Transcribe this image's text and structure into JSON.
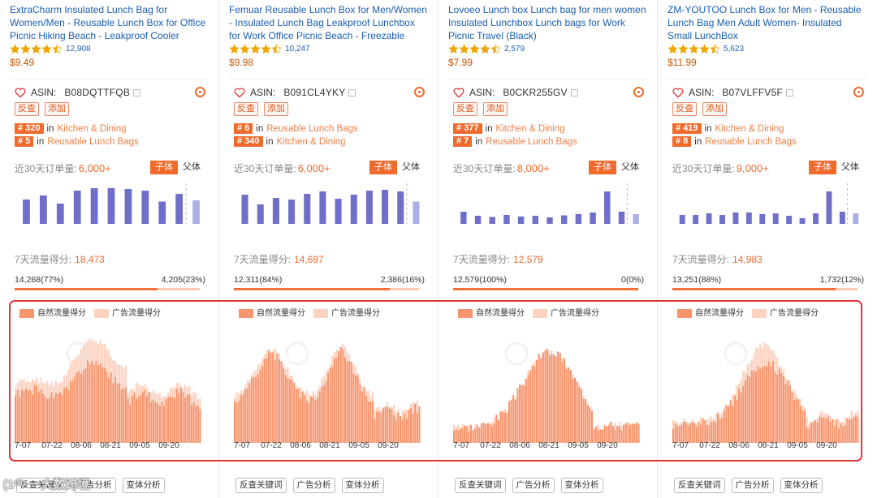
{
  "products": [
    {
      "title": "ExtraCharm Insulated Lunch Bag for Women/Men - Reusable Lunch Box for Office Picnic Hiking Beach - Leakproof Cooler Tote…",
      "rating_count": "12,908",
      "price": "$9.49",
      "asin_label": "ASIN:",
      "asin": "B08DQTTFQB",
      "tags": [
        "反查",
        "添加"
      ],
      "ranks": [
        {
          "num": "# 320",
          "in": "in",
          "cat": "Kitchen & Dining"
        },
        {
          "num": "# 5",
          "in": "in",
          "cat": "Reusable Lunch Bags"
        }
      ],
      "orders_label": "近30天订单量:",
      "orders_value": "6,000+",
      "toggle": [
        "子体",
        "父体"
      ],
      "bars": [
        0.6,
        0.7,
        0.5,
        0.82,
        0.88,
        0.88,
        0.86,
        0.82,
        0.55,
        0.74,
        0.58
      ],
      "traffic_label": "7天流量得分:",
      "traffic_value": "18,473",
      "natural": "14,268(77%)",
      "ads": "4,205(23%)",
      "natural_pct": 77,
      "legend": [
        "自然流量得分",
        "广告流量得分"
      ],
      "x_ticks": [
        "7-07",
        "07-22",
        "08-06",
        "08-21",
        "09-05",
        "09-20"
      ],
      "buttons": [
        "反查关键词",
        "广告分析",
        "变体分析"
      ],
      "seed": 1,
      "shape": "a"
    },
    {
      "title": "Femuar Reusable Lunch Box for Men/Women - Insulated Lunch Bag Leakproof Lunchbox for Work Office Picnic Beach - Freezable Lunch…",
      "rating_count": "10,247",
      "price": "$9.98",
      "asin_label": "ASIN:",
      "asin": "B091CL4YKY",
      "tags": [
        "反查",
        "添加"
      ],
      "ranks": [
        {
          "num": "# 6",
          "in": "in",
          "cat": "Reusable Lunch Bags"
        },
        {
          "num": "# 340",
          "in": "in",
          "cat": "Kitchen & Dining"
        }
      ],
      "orders_label": "近30天订单量:",
      "orders_value": "6,000+",
      "toggle": [
        "子体",
        "父体"
      ],
      "bars": [
        0.72,
        0.48,
        0.64,
        0.6,
        0.74,
        0.8,
        0.62,
        0.72,
        0.82,
        0.84,
        0.8,
        0.55
      ],
      "traffic_label": "7天流量得分:",
      "traffic_value": "14,697",
      "natural": "12,311(84%)",
      "ads": "2,386(16%)",
      "natural_pct": 84,
      "legend": [
        "自然流量得分",
        "广告流量得分"
      ],
      "x_ticks": [
        "7-07",
        "07-22",
        "08-06",
        "08-21",
        "09-05",
        "09-20"
      ],
      "buttons": [
        "反查关键词",
        "广告分析",
        "变体分析"
      ],
      "seed": 2,
      "shape": "b"
    },
    {
      "title": "Lovoeo Lunch box Lunch bag for men women Insulated Lunchbox Lunch bags for Work Picnic Travel (Black)",
      "rating_count": "2,579",
      "price": "$7.99",
      "asin_label": "ASIN:",
      "asin": "B0CKR255GV",
      "tags": [
        "反查",
        "添加"
      ],
      "ranks": [
        {
          "num": "# 377",
          "in": "in",
          "cat": "Kitchen & Dining"
        },
        {
          "num": "# 7",
          "in": "in",
          "cat": "Reusable Lunch Bags"
        }
      ],
      "orders_label": "近30天订单量:",
      "orders_value": "8,000+",
      "toggle": [
        "子体",
        "父体"
      ],
      "bars": [
        0.3,
        0.2,
        0.17,
        0.22,
        0.18,
        0.2,
        0.16,
        0.21,
        0.24,
        0.28,
        0.8,
        0.3,
        0.24
      ],
      "traffic_label": "7天流量得分:",
      "traffic_value": "12,579",
      "natural": "12,579(100%)",
      "ads": "0(0%)",
      "natural_pct": 100,
      "legend": [
        "自然流量得分",
        "广告流量得分"
      ],
      "x_ticks": [
        "7-07",
        "07-22",
        "08-06",
        "08-21",
        "09-05",
        "09-20"
      ],
      "buttons": [
        "反查关键词",
        "广告分析",
        "变体分析"
      ],
      "seed": 3,
      "shape": "c"
    },
    {
      "title": "ZM-YOUTOO Lunch Box for Men - Reusable Lunch Bag Men Adult Women- Insulated Small LunchBox",
      "rating_count": "5,623",
      "price": "$11.99",
      "asin_label": "ASIN:",
      "asin": "B07VLFFV5F",
      "tags": [
        "反查",
        "添加"
      ],
      "ranks": [
        {
          "num": "# 419",
          "in": "in",
          "cat": "Kitchen & Dining"
        },
        {
          "num": "# 8",
          "in": "in",
          "cat": "Reusable Lunch Bags"
        }
      ],
      "orders_label": "近30天订单量:",
      "orders_value": "9,000+",
      "toggle": [
        "子体",
        "父体"
      ],
      "bars": [
        0.22,
        0.22,
        0.26,
        0.22,
        0.28,
        0.28,
        0.24,
        0.26,
        0.2,
        0.14,
        0.26,
        0.8,
        0.3,
        0.26
      ],
      "traffic_label": "7天流量得分:",
      "traffic_value": "14,983",
      "natural": "13,251(88%)",
      "ads": "1,732(12%)",
      "natural_pct": 88,
      "legend": [
        "自然流量得分",
        "广告流量得分"
      ],
      "x_ticks": [
        "7-07",
        "07-22",
        "08-06",
        "08-21",
        "09-05",
        "09-20"
      ],
      "buttons": [
        "反查关键词",
        "广告分析",
        "变体分析"
      ],
      "seed": 4,
      "shape": "d"
    }
  ],
  "colors": {
    "accent": "#f06a2c",
    "bar_purple": "#6f6fc9",
    "bar_purple_light": "#aab0e6",
    "natural": "#f7956d",
    "ads": "#fcd2c0",
    "highlight_border": "#e2363b",
    "link_blue": "#1a5fb4",
    "star": "#f0a500"
  },
  "watermark": "(1ᵉˡᵒ 一大数跨境"
}
